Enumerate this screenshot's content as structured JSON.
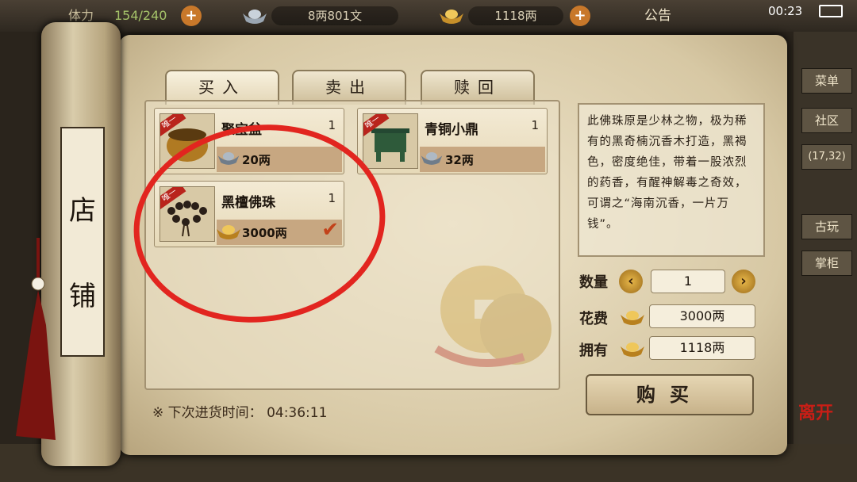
{
  "topbar": {
    "stamina_label": "体力",
    "stamina_value": "154/240",
    "silver_value": "8两801文",
    "gold_value": "1118两",
    "notice": "公告",
    "time": "00:23"
  },
  "side_buttons": [
    "菜单",
    "社区",
    "(17,32)",
    "古玩",
    "掌柜"
  ],
  "scroll_title": [
    "店",
    "铺"
  ],
  "tabs": [
    {
      "label": "买入"
    },
    {
      "label": "卖出"
    },
    {
      "label": "赎回"
    }
  ],
  "items": [
    {
      "name": "聚宝盆",
      "qty": "1",
      "price": "20两",
      "currency": "silver-ingot-icon",
      "tag": "唯一"
    },
    {
      "name": "青铜小鼎",
      "qty": "1",
      "price": "32两",
      "currency": "silver-ingot-icon",
      "tag": "唯一"
    },
    {
      "name": "黑檀佛珠",
      "qty": "1",
      "price": "3000两",
      "currency": "gold-ingot-icon",
      "tag": "唯一",
      "selected": true
    }
  ],
  "description": "此佛珠原是少林之物，极为稀有的黑奇楠沉香木打造，黑褐色，密度绝佳，带着一股浓烈的药香，有醒神解毒之奇效，可谓之“海南沉香，一片万钱”。",
  "quantity": {
    "label": "数量",
    "value": "1"
  },
  "cost": {
    "label": "花费",
    "value": "3000两"
  },
  "owned": {
    "label": "拥有",
    "value": "1118两"
  },
  "buy_label": "购买",
  "restock": {
    "label": "※ 下次进货时间：",
    "time": "04:36:11"
  },
  "leave_label": "离开",
  "colors": {
    "highlight_circle": "#e2251f",
    "accent": "#c8782a"
  }
}
